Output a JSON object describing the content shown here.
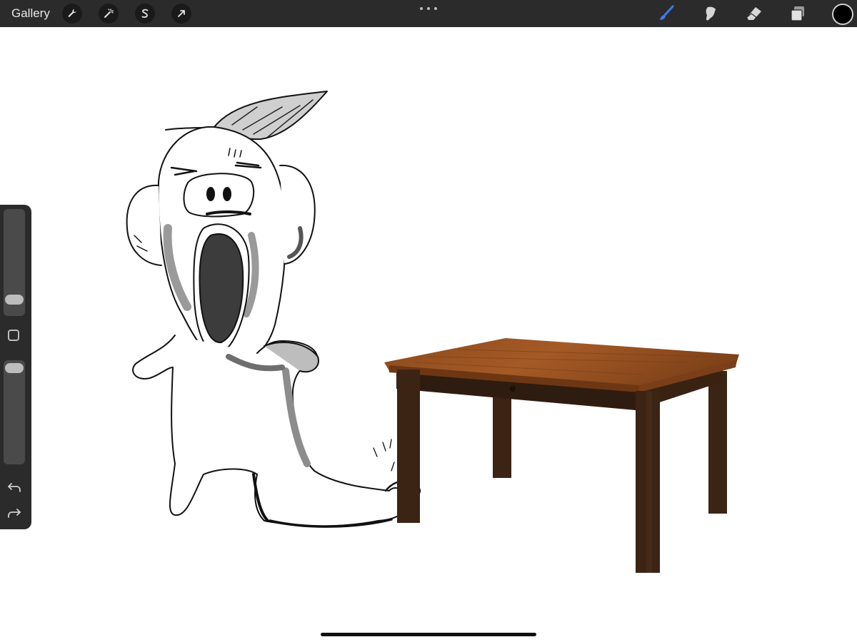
{
  "toolbar": {
    "gallery_label": "Gallery",
    "left_tools": [
      "wrench-icon",
      "magic-wand-icon",
      "selection-icon",
      "transform-arrow-icon"
    ],
    "right_tools": [
      "brush-icon",
      "smudge-icon",
      "eraser-icon",
      "layers-icon"
    ],
    "active_tool": "brush-icon",
    "active_tool_color": "#3d7bf0",
    "current_color": "#000000"
  },
  "sidebar": {
    "brush_size_level": 0.12,
    "opacity_level": 1.0,
    "undo_icon": "undo-icon",
    "redo_icon": "redo-icon",
    "modify_icon": "square-modify-icon"
  },
  "canvas": {
    "background": "#ffffff",
    "wood_color": "#8a4a1e",
    "leg_color": "#3b2414"
  }
}
